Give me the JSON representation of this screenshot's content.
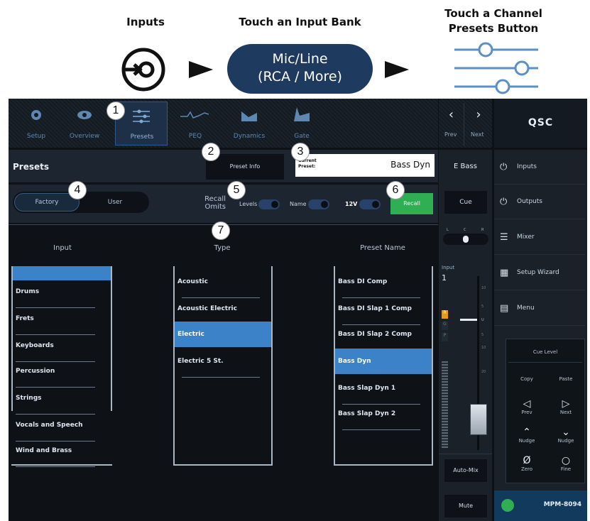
{
  "instructions": {
    "step1_label": "Inputs",
    "step2_label": "Touch an Input Bank",
    "step3_label_line1": "Touch a Channel",
    "step3_label_line2": "Presets Button",
    "bank_pill_line1": "Mic/Line",
    "bank_pill_line2": "(RCA / More)"
  },
  "callouts": [
    "1",
    "2",
    "3",
    "4",
    "5",
    "6",
    "7"
  ],
  "tabs": [
    {
      "label": "Setup",
      "icon": "gear-icon"
    },
    {
      "label": "Overview",
      "icon": "eye-icon"
    },
    {
      "label": "Presets",
      "icon": "sliders-icon"
    },
    {
      "label": "PEQ",
      "icon": "peq-curve-icon"
    },
    {
      "label": "Dynamics",
      "icon": "dynamics-icon"
    },
    {
      "label": "Gate",
      "icon": "gate-icon"
    }
  ],
  "nav": {
    "prev": "Prev",
    "next": "Next"
  },
  "brand": "QSC",
  "presets": {
    "title": "Presets",
    "preset_info_label": "Preset Info",
    "current_preset_label_1": "Current",
    "current_preset_label_2": "Preset:",
    "current_preset_value": "Bass Dyn",
    "factory_label": "Factory",
    "user_label": "User",
    "recall_omits_1": "Recall",
    "recall_omits_2": "Omits",
    "levels_label": "Levels",
    "name_label": "Name",
    "v12_label": "12V",
    "recall_label": "Recall",
    "col_input": "Input",
    "col_type": "Type",
    "col_preset_name": "Preset Name",
    "inputs": [
      "",
      "Drums",
      "Frets",
      "Keyboards",
      "Percussion",
      "Strings",
      "Vocals and Speech",
      "Wind and Brass"
    ],
    "types": [
      "Acoustic",
      "Acoustic Electric",
      "Electric",
      "Electric 5 St."
    ],
    "preset_names": [
      "Bass DI Comp",
      "Bass DI Slap 1 Comp",
      "Bass DI Slap 2 Comp",
      "Bass Dyn",
      "Bass Slap Dyn 1",
      "Bass Slap Dyn 2"
    ]
  },
  "channel": {
    "name": "E Bass",
    "cue": "Cue",
    "pan_l": "L",
    "pan_c": "C",
    "pan_r": "R",
    "input_label": "Input",
    "input_number": "1",
    "auto_mix": "Auto-Mix",
    "mute": "Mute",
    "meter_r": "R",
    "meter_g": "G",
    "meter_p": "P",
    "fader_marks": [
      "10",
      "5",
      "U",
      "5",
      "10",
      "20"
    ]
  },
  "right_menu": [
    {
      "label": "Inputs",
      "icon": "inputs-icon"
    },
    {
      "label": "Outputs",
      "icon": "outputs-icon"
    },
    {
      "label": "Mixer",
      "icon": "mixer-icon"
    },
    {
      "label": "Setup Wizard",
      "icon": "wizard-icon"
    },
    {
      "label": "Menu",
      "icon": "menu-icon"
    }
  ],
  "keypad": {
    "cue_level": "Cue Level",
    "copy": "Copy",
    "paste": "Paste",
    "prev": "Prev",
    "next": "Next",
    "nudge_up": "Nudge",
    "nudge_down": "Nudge",
    "zero": "Zero",
    "fine": "Fine"
  },
  "device_name": "MPM-8094",
  "colors": {
    "accent_blue": "#3b82c9",
    "recall_green": "#2fae53",
    "navy": "#1f3a5f",
    "outline_blue": "#5b8fc5"
  }
}
